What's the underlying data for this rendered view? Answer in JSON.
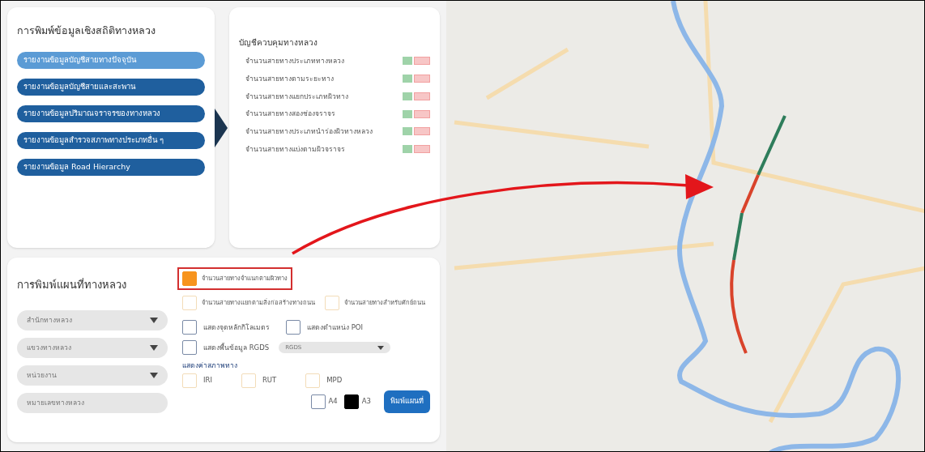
{
  "stats_panel": {
    "title": "การพิมพ์ข้อมูลเชิงสถิติทางหลวง",
    "reports": [
      {
        "label": "รายงานข้อมูลบัญชีสายทางปัจจุบัน",
        "selected": true
      },
      {
        "label": "รายงานข้อมูลบัญชีสายและสะพาน",
        "selected": false
      },
      {
        "label": "รายงานข้อมูลปริมาณจราจรของทางหลวง",
        "selected": false
      },
      {
        "label": "รายงานข้อมูลสำรวจสภาพทางประเภทอื่น ๆ",
        "selected": false
      },
      {
        "label": "รายงานข้อมูล Road Hierarchy",
        "selected": false
      }
    ]
  },
  "detail_panel": {
    "title": "บัญชีควบคุมทางหลวง",
    "items": [
      "จำนวนสายทางประเภททางหลวง",
      "จำนวนสายทางตามระยะทาง",
      "จำนวนสายทางแยกประเภทผิวทาง",
      "จำนวนสายทางสองช่องจราจร",
      "จำนวนสายทางประเภทนำร่องผิวทางหลวง",
      "จำนวนสายทางแบ่งตามผิวจราจร"
    ]
  },
  "map_panel": {
    "title": "การพิมพ์แผนที่ทางหลวง",
    "selects": [
      "สำนักทางหลวง",
      "แขวงทางหลวง",
      "หน่วยงาน"
    ],
    "road_number": {
      "placeholder": "หมายเลขทางหลวง"
    },
    "layers": [
      {
        "label": "จำนวนสายทางจำแนกตามผิวทาง",
        "kind": "layer",
        "checked": true,
        "highlighted": true
      },
      {
        "label": "จำนวนสายทางแยกตามสิ่งก่อสร้างทางถนน",
        "kind": "layer",
        "checked": false,
        "highlighted": false
      },
      {
        "label": "จำนวนสายทางสำหรับศักย์ถนน",
        "kind": "layer",
        "checked": false,
        "highlighted": false
      }
    ],
    "options": [
      {
        "label": "แสดงจุดหลักกิโลเมตร",
        "checked": false
      },
      {
        "label": "แสดงตำแหน่ง POI",
        "checked": false
      }
    ],
    "rgds": {
      "label": "แสดงพื้นข้อมูล RGDS",
      "checked": false,
      "value": "RGDS"
    },
    "condition_title": "แสดงค่าสภาพทาง",
    "conditions": [
      {
        "label": "IRI",
        "checked": false
      },
      {
        "label": "RUT",
        "checked": false
      },
      {
        "label": "MPD",
        "checked": false
      }
    ],
    "paper": [
      {
        "label": "A4",
        "selected": false
      },
      {
        "label": "A3",
        "selected": true
      }
    ],
    "print_button": "พิมพ์แผนที่"
  },
  "map": {
    "route_segments": [
      {
        "color": "#2e7d5b"
      },
      {
        "color": "#d9432b"
      },
      {
        "color": "#2e7d5b"
      },
      {
        "color": "#d9432b"
      }
    ]
  }
}
